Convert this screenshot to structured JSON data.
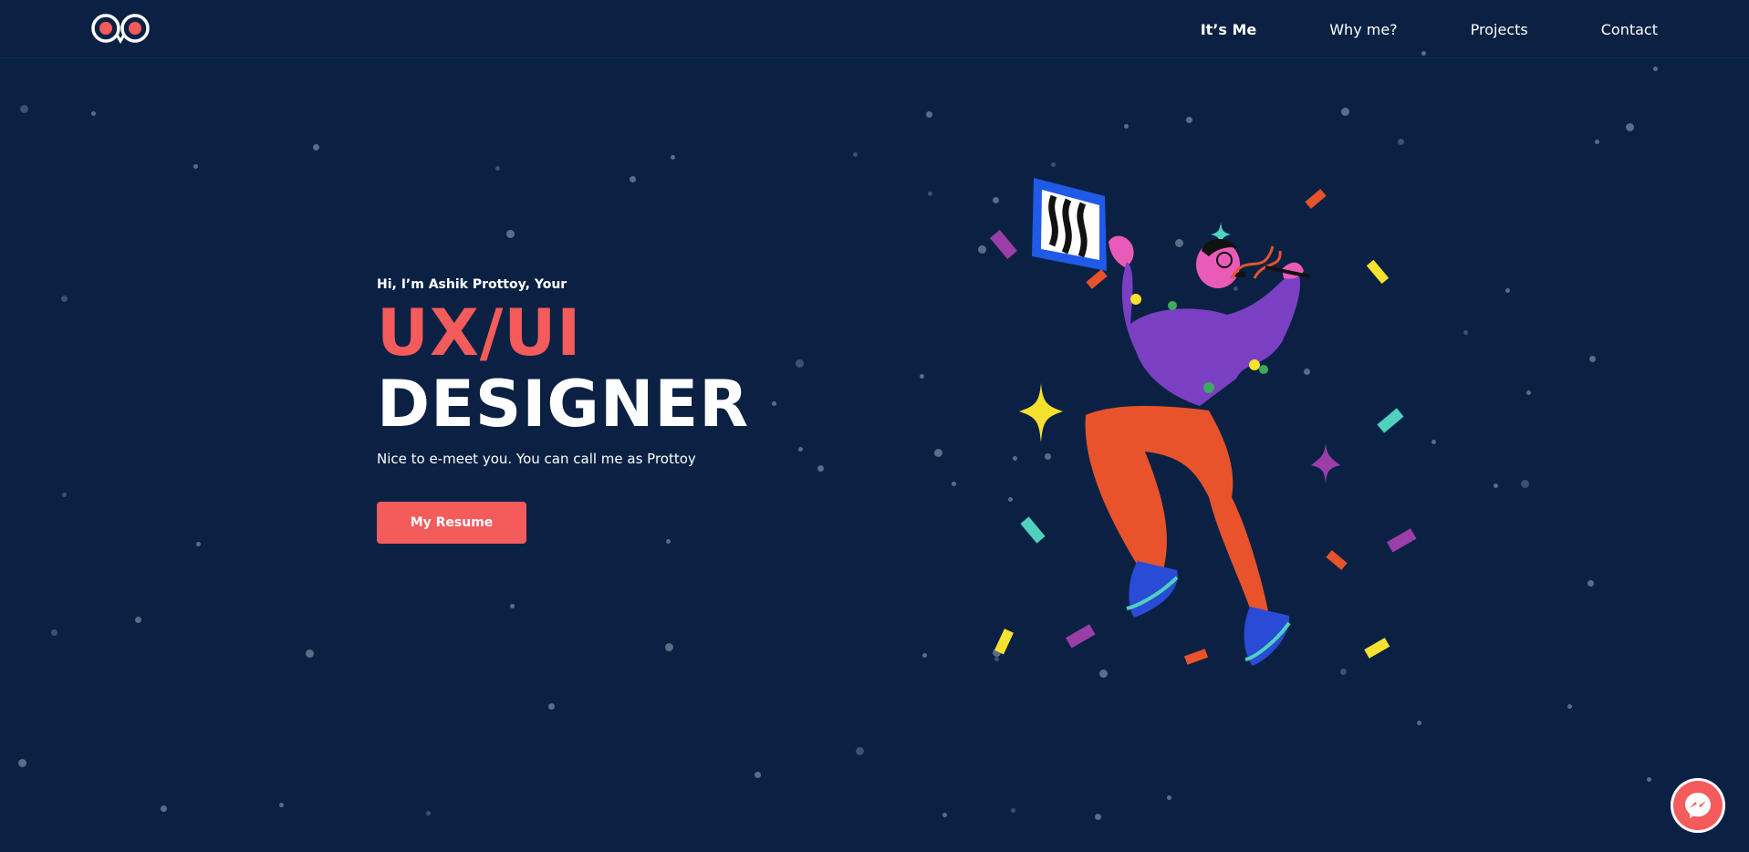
{
  "nav": {
    "logo_icon": "logo-mark",
    "links": [
      {
        "label": "It’s Me",
        "active": true
      },
      {
        "label": "Why me?",
        "active": false
      },
      {
        "label": "Projects",
        "active": false
      },
      {
        "label": "Contact",
        "active": false
      }
    ]
  },
  "hero": {
    "intro_prefix": "Hi, I’m",
    "intro_name": "Ashik Prottoy",
    "intro_suffix": ", Your",
    "title_line1": "UX/UI",
    "title_line2": "DESIGNER",
    "tagline": "Nice to e-meet you. You can call me as Prottoy",
    "resume_label": "My Resume"
  },
  "chat": {
    "icon": "messenger-icon"
  },
  "colors": {
    "background": "#0b2144",
    "accent": "#f45b5b",
    "text": "#ffffff"
  }
}
